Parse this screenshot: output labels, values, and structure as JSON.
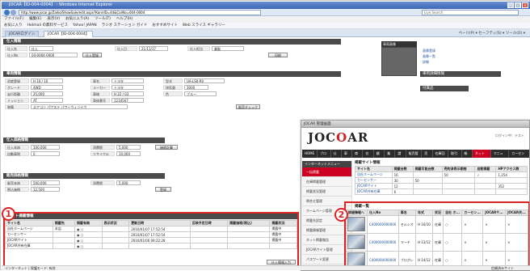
{
  "window": {
    "title": "JOCAR【ID-004-0004】 - Windows Internet Explorer",
    "address": "http://www.jocar.jp/Zaiko/ShowSale/edit.aspx?KanriID=44&CarNo=004-0004",
    "search_placeholder": "Live Search"
  },
  "menu": [
    "ファイル(F)",
    "編集(E)",
    "表示(V)",
    "お気に入り(A)",
    "ツール(T)",
    "ヘルプ(H)"
  ],
  "favorites": [
    "お気に入り",
    "Hotmail の無料サービス",
    "Yahoo! JAPAN",
    "ラジオ ステーション ガイド",
    "おすすめサイト",
    "Web スライス ギャラリー"
  ],
  "tabs": [
    "JOCARログイン",
    "JOCAR【ID-004-0004】"
  ],
  "tab_tools": "ページ(P) ▾  セーフティ(S) ▾  ツール(O) ▾",
  "main": {
    "section1": "仕入情報",
    "fields1": [
      {
        "label": "仕入先",
        "value": "仕入"
      },
      {
        "label": "仕入日",
        "value": "21/11/17"
      },
      {
        "label": "仕入担当",
        "value": "業販"
      },
      {
        "label": "仕入No",
        "value": "04-0004-0000"
      }
    ],
    "section2": "車両情報",
    "fields2": [
      {
        "label": "初度登録",
        "value": "H 16 / 10"
      },
      {
        "label": "車名",
        "value": "トヨタ"
      },
      {
        "label": "型式",
        "value": "UA-LS0-R0"
      },
      {
        "label": "グレード",
        "value": "4WD"
      },
      {
        "label": "メーカー",
        "value": "トヨタ"
      },
      {
        "label": "排気量",
        "value": "3000"
      },
      {
        "label": "走行距離",
        "value": "25,000"
      },
      {
        "label": "車検",
        "value": "H 22 / 03"
      },
      {
        "label": "色",
        "value": "ブルー"
      },
      {
        "label": "ミッション",
        "value": "AT"
      },
      {
        "label": "車体番号",
        "value": "1234567"
      },
      {
        "label": "装備",
        "value": "エアコン パワステ パワーウィンドウ"
      }
    ],
    "section3": "仕入価格情報",
    "fields3": [
      {
        "label": "仕入本体",
        "value": "100,000"
      },
      {
        "label": "消費税",
        "value": "5,000"
      },
      {
        "label": "自動車税",
        "value": "0"
      },
      {
        "label": "リサイクル",
        "value": "10,000"
      }
    ],
    "section4": "販売価格情報",
    "fields4": [
      {
        "label": "販売本体",
        "value": "500,000"
      },
      {
        "label": "消費税",
        "value": "5,000"
      },
      {
        "label": "税込価格",
        "value": "12,500"
      }
    ],
    "section5": "ネット掲載情報",
    "net_headers": [
      "サイト名",
      "掲載先",
      "掲載有無",
      "表示状況",
      "更新日時",
      "反映予定日時",
      "掲載価格(税込)",
      "掲載状況"
    ],
    "net_rows": [
      {
        "site": "自社ホームページ",
        "dest": "本店",
        "date": "2010/01/07 17:52:54",
        "status": "掲載中"
      },
      {
        "site": "カーセンサー",
        "dest": "",
        "date": "2010/01/07 17:52:54",
        "status": "掲載中"
      },
      {
        "site": "JOCARサイト",
        "dest": "",
        "date": "2010/01/06 09:22:28",
        "status": "掲載中"
      },
      {
        "site": "JOCAR共有在庫",
        "dest": "",
        "date": "",
        "status": ""
      }
    ],
    "buttons": {
      "sale_check": "販売チェック",
      "price_calc": "価格計算",
      "update": "登録",
      "upload_btn": "仕入登録",
      "print": "印刷",
      "delete": "削除",
      "submit": "仕入情報入力"
    },
    "right_box": {
      "title": "車両画像",
      "links": [
        "画像登録",
        "画像一覧",
        "詳細"
      ],
      "side_title": "車両詳細情報",
      "side_title2": "付属品"
    }
  },
  "popup": {
    "title": "JOCAR 管理画面",
    "logo_prefix": "JOC",
    "logo_o": "O",
    "logo_suffix": "AR",
    "nav": [
      "HOME",
      "ブログ",
      "仕入",
      "車両",
      "商談",
      "在庫",
      "顧客",
      "業者",
      "請求",
      "販売管理",
      "売上",
      "在庫回転",
      "取引先",
      "帳票",
      "ネット掲載",
      "マニュアル",
      "カーセンサー"
    ],
    "nav_active": "ネット掲載",
    "sidebar_head": "インターネットメニュー",
    "sidebar_items": [
      "一括掲載",
      "在庫掲載管理",
      "掲載状況管理",
      "問合せ管理",
      "ホームページ管理",
      "掲載先設定",
      "掲載情報管理",
      "ネット掲載報告",
      "JOCARサイト管理",
      "パスワード変更"
    ],
    "sidebar_active": "一括掲載",
    "summary_title": "掲載サイト情報",
    "summary_headers": [
      "サイト名",
      "掲載台数",
      "掲載可能台数",
      "売約済表示期間",
      "自動掲載",
      "HPアクセス数"
    ],
    "summary_rows": [
      [
        "自社ホームページ",
        "16",
        "",
        "50",
        "✓",
        "1,254"
      ],
      [
        "カーセンサー",
        "30",
        "50",
        "",
        "",
        ""
      ],
      [
        "JOCARサイト",
        "12",
        "",
        "",
        "",
        "352"
      ],
      [
        "JOCAR共有在庫",
        "6",
        "",
        "",
        "",
        ""
      ]
    ],
    "list_title": "掲載一覧",
    "list_headers": [
      "詳細情報へ",
      "仕入No",
      "車名",
      "年式",
      "状況",
      "自社 ホ...",
      "カーセン...",
      "JOCARサ...",
      "JOCAR共..."
    ],
    "list_rows": [
      {
        "no": "C400000000000",
        "car": "セルシオ",
        "year": "H 16/10",
        "state": "在庫",
        "a": "○",
        "b": "×",
        "c": "×",
        "d": "×"
      },
      {
        "no": "C400000000000",
        "car": "マーチ",
        "year": "H 13/12",
        "state": "在庫",
        "a": "○",
        "b": "×",
        "c": "×",
        "d": "×"
      },
      {
        "no": "C400000000000",
        "car": "プログレ",
        "year": "H 14/12",
        "state": "在庫",
        "a": "○",
        "b": "×",
        "c": "×",
        "d": "×"
      }
    ],
    "login_user": "ログイン中：テスト"
  },
  "callouts": {
    "one": "1",
    "two": "2"
  },
  "statusbar": "インターネット | 保護モード: 有効",
  "statusbar_right": "信頼済みサイト",
  "colors": {
    "accent_red": "#dd2222",
    "nav_dark": "#2b2b2b",
    "active_red": "#cc0022"
  }
}
